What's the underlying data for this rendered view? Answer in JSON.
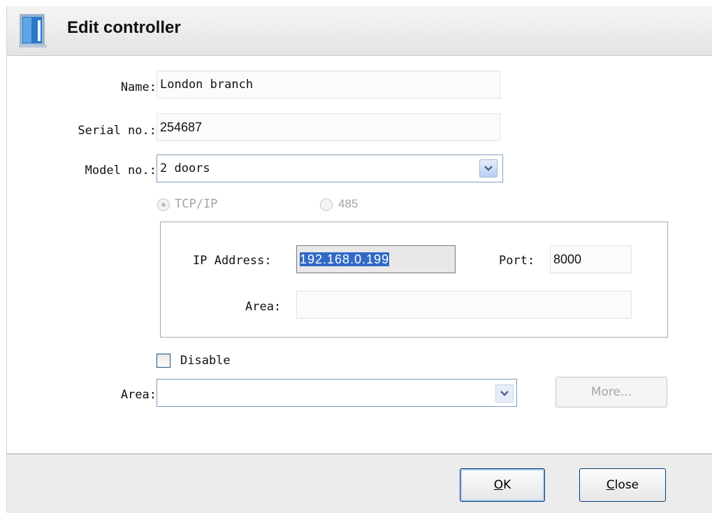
{
  "dialog": {
    "title": "Edit controller"
  },
  "form": {
    "name_label": "Name:",
    "name_value": "London branch",
    "serial_label": "Serial no.:",
    "serial_value": "254687",
    "model_label": "Model no.:",
    "model_value": "2 doors",
    "connection": {
      "tcpip_label": "TCP/IP",
      "tcpip_selected": true,
      "rs485_label": "485",
      "rs485_selected": false
    },
    "ip_label": "IP Address:",
    "ip_value": "192.168.0.199",
    "port_label": "Port:",
    "port_value": "8000",
    "inner_area_label": "Area:",
    "inner_area_value": "",
    "disable_label": "Disable",
    "disable_checked": false,
    "area_label": "Area:",
    "area_value": ""
  },
  "buttons": {
    "more_label": "More...",
    "ok_mnemonic": "O",
    "ok_rest": "K",
    "close_mnemonic": "C",
    "close_rest": "lose"
  },
  "icons": {
    "title_icon": "door-icon",
    "dropdown_icon": "chevron-down-icon"
  },
  "colors": {
    "selection": "#316ac5",
    "button_border": "#003c74",
    "dropdown_button": "#b9cdf1"
  }
}
